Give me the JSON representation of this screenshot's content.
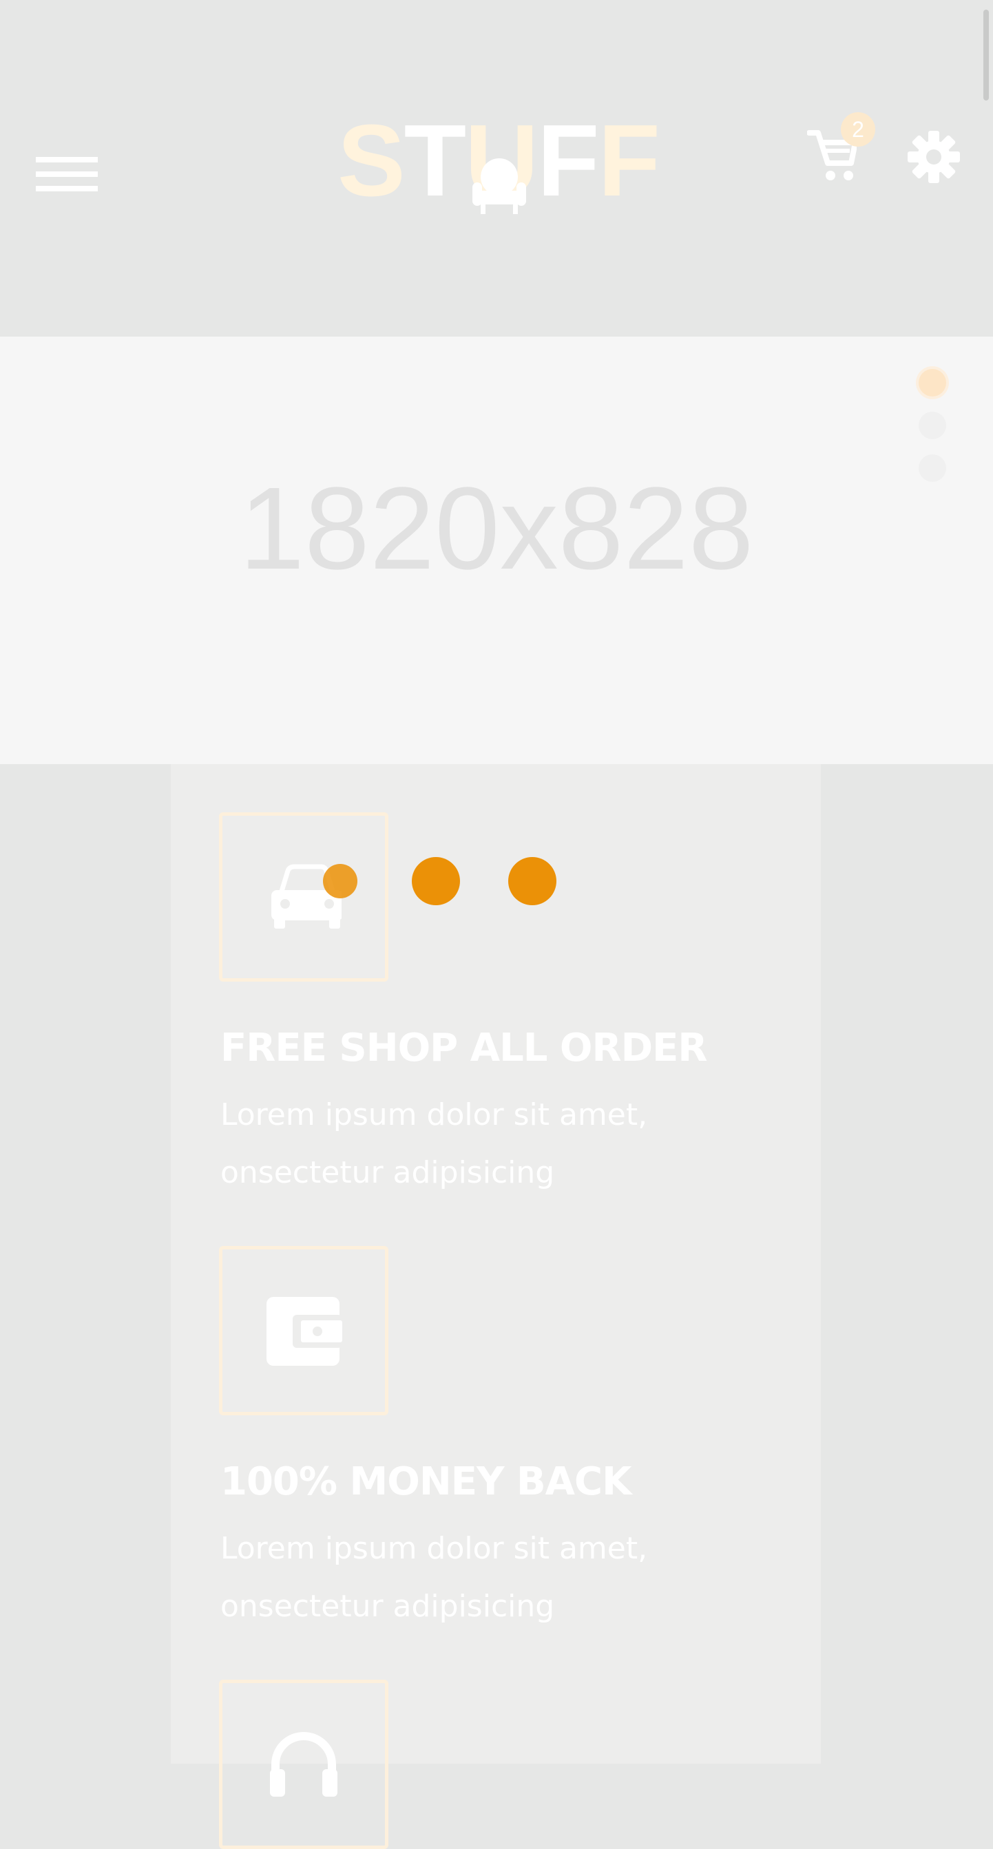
{
  "header": {
    "logo": {
      "letters": [
        "S",
        "T",
        "U",
        "F",
        "F"
      ]
    },
    "cart": {
      "count": "2"
    },
    "icons": [
      "menu-icon",
      "armchair-icon",
      "cart-icon",
      "gear-icon"
    ]
  },
  "slider": {
    "placeholder": "1820x828",
    "slide_count": 3,
    "active_slide": 1
  },
  "features": [
    {
      "icon": "car-icon",
      "title": "FREE SHOP ALL ORDER",
      "desc_line1": "Lorem ipsum dolor sit amet,",
      "desc_line2": "onsectetur adipisicing"
    },
    {
      "icon": "wallet-icon",
      "title": "100% MONEY BACK",
      "desc_line1": "Lorem ipsum dolor sit amet,",
      "desc_line2": "onsectetur adipisicing"
    },
    {
      "icon": "support-icon",
      "title": "",
      "desc_line1": "",
      "desc_line2": ""
    }
  ],
  "colors": {
    "loader": "#eb9107",
    "logo_accent": "#fff3dd",
    "background": "#e6e7e6",
    "slider_background": "#f6f6f6",
    "badge": "#fce9cc"
  }
}
